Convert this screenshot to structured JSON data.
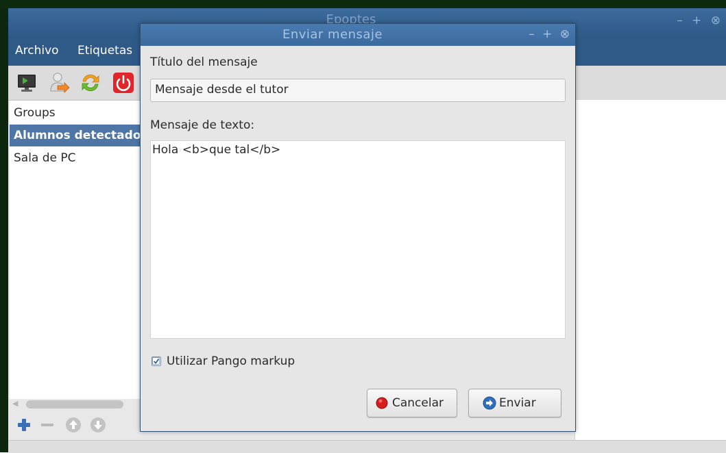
{
  "main_window": {
    "title": "Epoptes",
    "controls": [
      "–",
      "+",
      "⊗"
    ],
    "menu": [
      "Archivo",
      "Etiquetas"
    ],
    "toolbar_icons": [
      "monitor-icon",
      "user-arrow-icon",
      "refresh-icon",
      "power-icon"
    ],
    "groups": [
      "Groups",
      "Alumnos detectados",
      "Sala de PC"
    ],
    "selected_group_index": 1,
    "group_buttons": [
      "add-icon",
      "remove-icon",
      "move-up-icon",
      "move-down-icon"
    ]
  },
  "dialog": {
    "title": "Enviar mensaje",
    "controls": [
      "–",
      "+",
      "⊗"
    ],
    "title_label": "Título del mensaje",
    "title_value": "Mensaje desde el tutor",
    "message_label": "Mensaje de texto:",
    "message_value": "Hola <b>que tal</b>",
    "pango_label": "Utilizar Pango markup",
    "pango_checked": true,
    "cancel_label": "Cancelar",
    "send_label": "Enviar"
  },
  "colors": {
    "titlebar": "#3d6b9c",
    "selection": "#4d76a6",
    "cancel_icon": "#d61d1d",
    "send_icon": "#2f6fbf"
  }
}
